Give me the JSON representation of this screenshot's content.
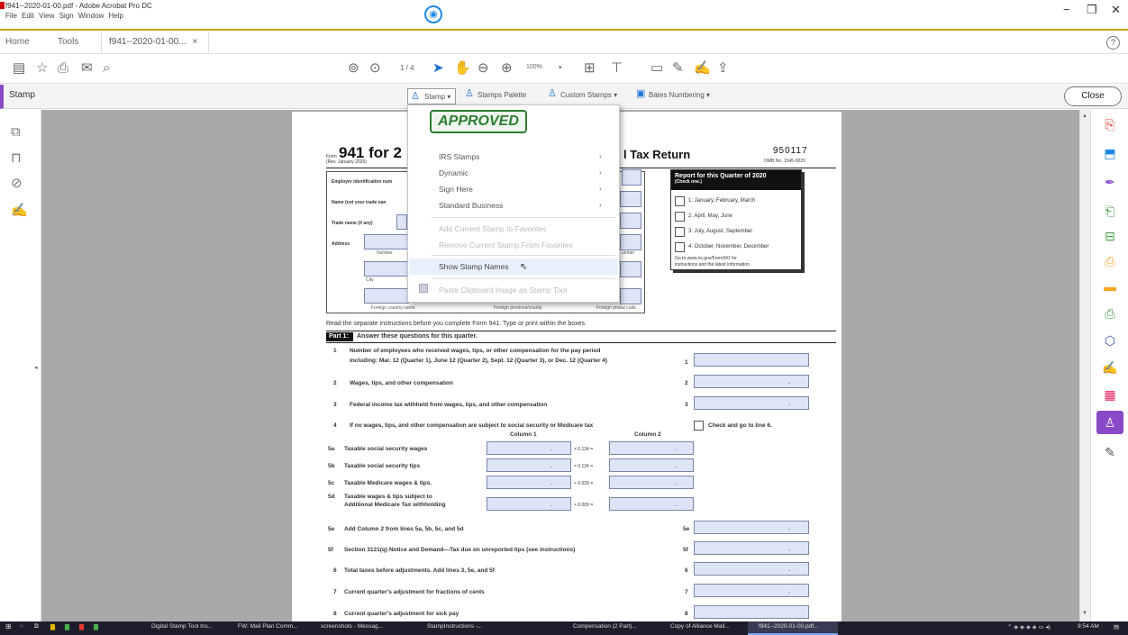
{
  "window": {
    "title": "f941--2020-01-00.pdf - Adobe Acrobat Pro DC",
    "menu": [
      "File",
      "Edit",
      "View",
      "Sign",
      "Window",
      "Help"
    ],
    "controls": {
      "minimize": "−",
      "maximize": "❐",
      "close": "✕"
    }
  },
  "tabs": {
    "home": "Home",
    "tools": "Tools",
    "doc": "f941--2020-01-00...",
    "doc_close": "×",
    "help": "?"
  },
  "toolbar": {
    "page_current": "1",
    "page_total": "/ 4",
    "zoom": "100%"
  },
  "stampbar": {
    "title": "Stamp",
    "stamp": "Stamp ▾",
    "stamps_palette": "Stamps Palette",
    "custom_stamps": "Custom Stamps ▾",
    "bates": "Bates Numbering ▾",
    "close": "Close"
  },
  "menu": {
    "approved": "APPROVED",
    "items": [
      {
        "label": "IRS Stamps",
        "arrow": "›"
      },
      {
        "label": "Dynamic",
        "arrow": "›"
      },
      {
        "label": "Sign Here",
        "arrow": "›"
      },
      {
        "label": "Standard Business",
        "arrow": "›"
      }
    ],
    "add_favorites": "Add Current Stamp to Favorites",
    "remove_favorites": "Remove Current Stamp From Favorites",
    "show_names": "Show Stamp Names",
    "paste": "Paste Clipboard Image as Stamp Tool"
  },
  "form": {
    "form_word": "Form",
    "form_title": "941 for 2",
    "rev": "(Rev. January 2020)",
    "return_title": "l Tax Return",
    "code": "950117",
    "omb": "OMB No. 1545-0029",
    "ein": "Employer identification num",
    "name": "Name (not your trade nan",
    "trade": "Trade name (if any)",
    "address": "Address",
    "number": "Number",
    "city": "City",
    "street_end": "umber",
    "foreign_country": "Foreign country name",
    "foreign_province": "Foreign province/county",
    "foreign_postal": "Foreign postal code",
    "quarter_title": "Report for this Quarter of 2020",
    "quarter_check": "(Check one.)",
    "quarters": [
      "1: January, February, March",
      "2: April, May, June",
      "3: July, August, September",
      "4: October, November, December"
    ],
    "goto": "Go to www.irs.gov/Form941 for",
    "goto2": "instructions and the latest information.",
    "read": "Read the separate instructions before you complete Form 941. Type or print within the boxes.",
    "part1": "Part 1:",
    "part1_title": "Answer these questions for this quarter.",
    "q1a": "Number of employees who received wages, tips, or other compensation for the pay period",
    "q1b": "including: Mar. 12 (Quarter 1), June 12 (Quarter 2), Sept. 12 (Quarter 3), or Dec. 12 (Quarter 4)",
    "q2": "Wages, tips, and other compensation",
    "q3": "Federal income tax withheld from wages, tips, and other compensation",
    "q4": "If no wages, tips, and other compensation are subject to social security or Medicare tax",
    "q4b": "Check and go to line 6.",
    "col1": "Column 1",
    "col2": "Column 2",
    "q5a": "Taxable social security wages",
    "q5b": "Taxable social security tips",
    "q5c": "Taxable Medicare wages & tips.",
    "q5d1": "Taxable wages & tips subject to",
    "q5d2": "Additional Medicare Tax withholding",
    "m5a": "× 0.124 =",
    "m5b": "× 0.124 =",
    "m5c": "× 0.029 =",
    "m5d": "× 0.009 =",
    "q5e": "Add Column 2 from lines 5a, 5b, 5c, and 5d",
    "q5f": "Section 3121(q) Notice and Demand—Tax due on unreported tips (see instructions)",
    "q6": "Total taxes before adjustments. Add lines 3, 5e, and 5f",
    "q7": "Current quarter's adjustment for fractions of cents",
    "q8": "Current quarter's adjustment for sick pay",
    "nums": {
      "n1": "1",
      "n2": "2",
      "n3": "3",
      "n4": "4",
      "n5a": "5a",
      "n5b": "5b",
      "n5c": "5c",
      "n5d": "5d",
      "n5e": "5e",
      "n5f": "5f",
      "n6": "6",
      "n7": "7",
      "n8": "8"
    },
    "dot": "."
  },
  "taskbar": {
    "items": [
      "Digital Stamp Tool Ins...",
      "FW: Mail Plan Comm...",
      "screenshots - Messag...",
      "StampInstructions -...",
      "Compensation (2 Part)...",
      "Copy of Alliance Mail...",
      "f941--2020-01-00.pdf..."
    ],
    "time": "9:54 AM"
  },
  "colors": {
    "accent": "#8a4ac8",
    "approved": "#2e7d32",
    "titlebar_border": "#d4a000"
  }
}
